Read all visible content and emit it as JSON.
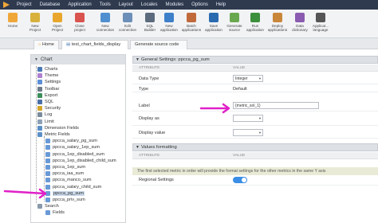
{
  "menubar": {
    "items": [
      "Project",
      "Database",
      "Application",
      "Tools",
      "Layout",
      "Locales",
      "Modules",
      "Options",
      "Help"
    ]
  },
  "toolbar": {
    "buttons": [
      {
        "label": "Home",
        "icon": "home-icon",
        "color": "#f0a73a"
      },
      {
        "label": "New\nProject",
        "icon": "new-project-icon",
        "color": "#d8b13c"
      },
      {
        "label": "Open\nProject",
        "icon": "open-project-icon",
        "color": "#e8a72c"
      },
      {
        "label": "Close\nproject",
        "icon": "close-project-icon",
        "color": "#d9534f"
      },
      {
        "label": "New\nconnection",
        "icon": "new-connection-icon",
        "color": "#4f8fcf"
      },
      {
        "label": "Edit\nconnection",
        "icon": "edit-connection-icon",
        "color": "#6b8fb8"
      },
      {
        "label": "SQL\nBuilder",
        "icon": "sql-builder-icon",
        "color": "#5b6b7d"
      },
      {
        "label": "New\napplication",
        "icon": "new-application-icon",
        "color": "#3d7fc9"
      },
      {
        "label": "Batch\napplications",
        "icon": "batch-applications-icon",
        "color": "#c06a3b"
      },
      {
        "label": "Save\napplication",
        "icon": "save-application-icon",
        "color": "#2a6bb0"
      },
      {
        "label": "Generate\nsource",
        "icon": "generate-source-icon",
        "color": "#6aa84f"
      },
      {
        "label": "Run\napplication",
        "icon": "run-application-icon",
        "color": "#3c8f3c"
      },
      {
        "label": "Deploy\napplications",
        "icon": "deploy-applications-icon",
        "color": "#c9873a"
      },
      {
        "label": "Data\ndictionary",
        "icon": "data-dictionary-icon",
        "color": "#8a5bb0"
      },
      {
        "label": "Applicat...\nlanguage",
        "icon": "application-language-icon",
        "color": "#555555"
      }
    ]
  },
  "tabs": [
    {
      "label": "Home",
      "icon": "home-icon"
    },
    {
      "label": "test_chart_fields_display",
      "active": true
    },
    {
      "label": "Generate source code"
    }
  ],
  "left_panel": {
    "title": "Chart",
    "tree": [
      {
        "label": "Charts",
        "icon": "charts-icon",
        "color": "#4a78b5",
        "level": 1
      },
      {
        "label": "Theme",
        "icon": "theme-icon",
        "color": "#b07fd0",
        "level": 1
      },
      {
        "label": "Settings",
        "icon": "settings-icon",
        "color": "#5c8fd6",
        "level": 1
      },
      {
        "label": "Toolbar",
        "icon": "toolbar-icon",
        "color": "#6c7a8a",
        "level": 1
      },
      {
        "label": "Export",
        "icon": "export-icon",
        "color": "#3a8e5a",
        "level": 1
      },
      {
        "label": "SQL",
        "icon": "sql-icon",
        "color": "#4d6fa8",
        "level": 1
      },
      {
        "label": "Security",
        "icon": "security-icon",
        "color": "#d4a52a",
        "level": 1
      },
      {
        "label": "Log",
        "icon": "log-icon",
        "color": "#7a8b9c",
        "level": 1
      },
      {
        "label": "Limit",
        "icon": "limit-icon",
        "color": "#8da0b5",
        "level": 1
      },
      {
        "label": "Dimension Fields",
        "icon": "dimension-fields-icon",
        "color": "#5b8fc7",
        "level": 1
      },
      {
        "label": "Metric Fields",
        "icon": "metric-fields-icon",
        "color": "#5b8fc7",
        "level": 1
      },
      {
        "label": "ppcca_salary_pg_sum",
        "icon": "field-icon",
        "color": "#6a9ad6",
        "level": 2
      },
      {
        "label": "ppcca_salary_1ep_sum",
        "icon": "field-icon",
        "color": "#6a9ad6",
        "level": 2
      },
      {
        "label": "ppcca_1ep_disabled_sum",
        "icon": "field-icon",
        "color": "#6a9ad6",
        "level": 2
      },
      {
        "label": "ppcca_1ep_disabled_child_sum",
        "icon": "field-icon",
        "color": "#6a9ad6",
        "level": 2
      },
      {
        "label": "ppcca_1ep_sum",
        "icon": "field-icon",
        "color": "#6a9ad6",
        "level": 2
      },
      {
        "label": "ppcca_iaa_sum",
        "icon": "field-icon",
        "color": "#6a9ad6",
        "level": 2
      },
      {
        "label": "ppcca_manco_sum",
        "icon": "field-icon",
        "color": "#6a9ad6",
        "level": 2
      },
      {
        "label": "ppcca_salary_child_sum",
        "icon": "field-icon",
        "color": "#6a9ad6",
        "level": 2
      },
      {
        "label": "ppcca_pg_sum",
        "icon": "field-icon",
        "color": "#6a9ad6",
        "level": 2,
        "selected": true
      },
      {
        "label": "ppcca_priv_sum",
        "icon": "field-icon",
        "color": "#6a9ad6",
        "level": 2
      },
      {
        "label": "Search",
        "icon": "search-icon",
        "color": "#8a9aab",
        "level": 1
      },
      {
        "label": "Fields",
        "icon": "fields-icon",
        "color": "#6a9ad6",
        "level": 2
      }
    ]
  },
  "right_panel": {
    "general": {
      "title": "General Settings: ppcca_pg_sum",
      "col_attribute": "ATTRIBUTE",
      "col_value": "VALUE",
      "rows": [
        {
          "name": "Data Type",
          "kind": "select",
          "value": "Integer"
        },
        {
          "name": "Type",
          "kind": "text",
          "value": "Default"
        },
        {
          "name": "Label",
          "kind": "input",
          "value": "{metric_sol_1}"
        },
        {
          "name": "Display as",
          "kind": "select",
          "value": ""
        },
        {
          "name": "Display value",
          "kind": "select",
          "value": ""
        }
      ]
    },
    "values": {
      "title": "Values formatting",
      "col_attribute": "ATTRIBUTE",
      "col_value": "VALUE",
      "info": "The first selected metric in order will provide the format settings for the other metrics in the same Y axis",
      "rows": [
        {
          "name": "Regional Settings",
          "kind": "toggle",
          "value": "on"
        }
      ]
    }
  },
  "colors": {
    "menubar": "#2f3a4f",
    "annotation": "#e020c8",
    "accent": "#3a8ee6"
  }
}
